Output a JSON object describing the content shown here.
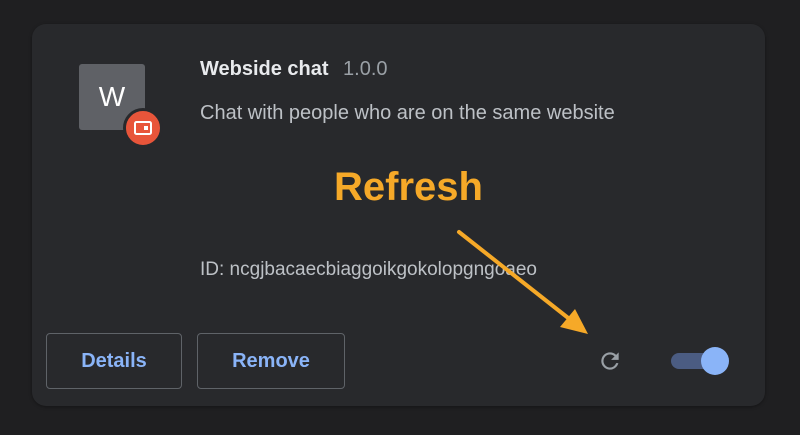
{
  "extension": {
    "icon_letter": "W",
    "name": "Webside chat",
    "version": "1.0.0",
    "description": "Chat with people who are on the same website",
    "id_text": "ID: ncgjbacaecbiaggoikgokolopgngoaeo"
  },
  "actions": {
    "details_label": "Details",
    "remove_label": "Remove"
  },
  "toggle": {
    "enabled": true
  },
  "annotation": {
    "label": "Refresh",
    "color": "#f6a928"
  },
  "colors": {
    "accent": "#8ab4f8",
    "badge": "#e8553a",
    "card": "#28292c",
    "background": "#1f1f21"
  },
  "icons": {
    "badge": "developer-mode-badge-icon",
    "refresh": "refresh-icon",
    "arrow": "annotation-arrow-icon"
  }
}
